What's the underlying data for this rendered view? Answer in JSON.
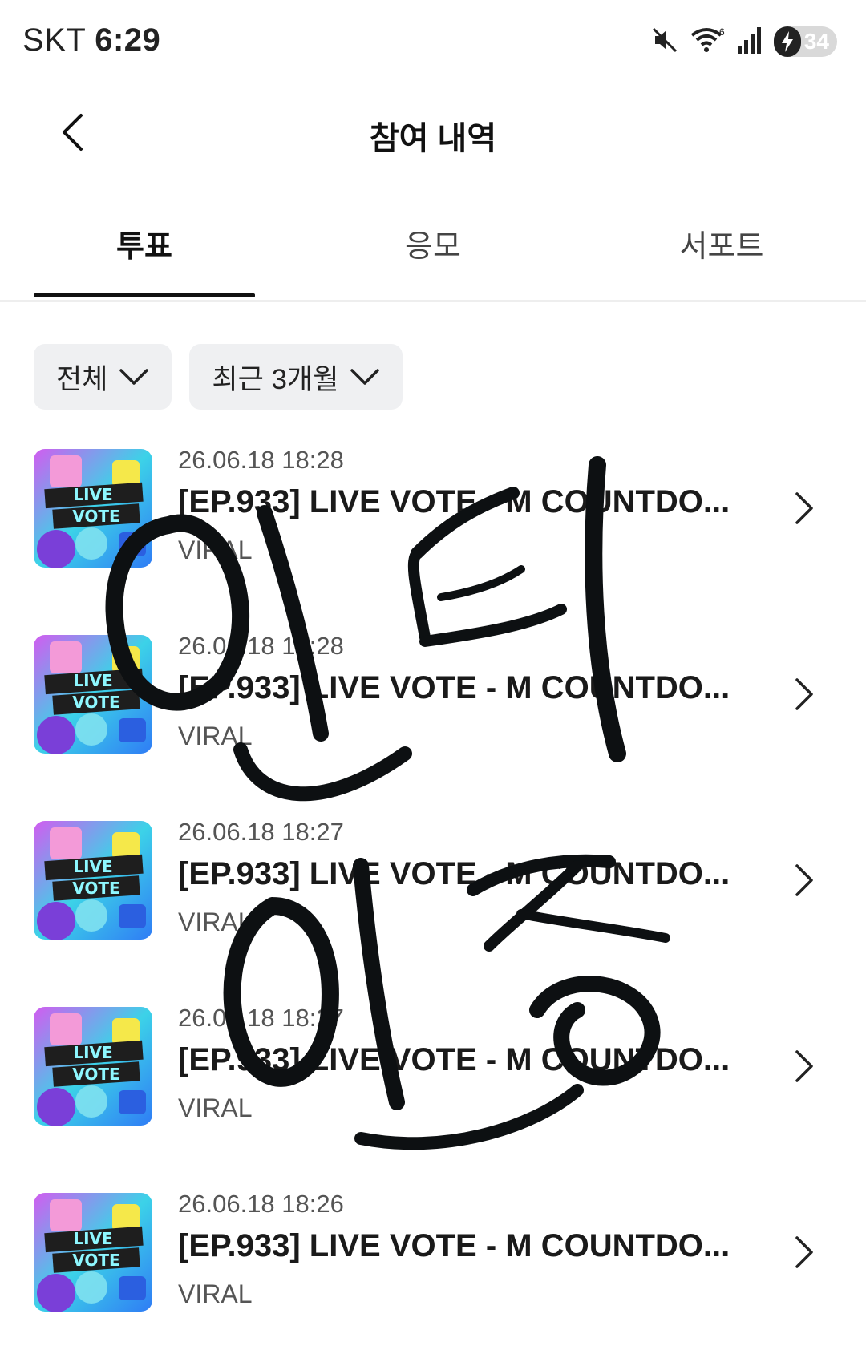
{
  "status_bar": {
    "carrier": "SKT",
    "time": "6:29",
    "battery": "34",
    "icons": [
      "mute-icon",
      "wifi-icon",
      "signal-icon",
      "battery-charging-icon"
    ]
  },
  "header": {
    "title": "참여 내역",
    "back_icon": "chevron-left-icon"
  },
  "tabs": [
    {
      "label": "투표",
      "active": true
    },
    {
      "label": "응모",
      "active": false
    },
    {
      "label": "서포트",
      "active": false
    }
  ],
  "filters": [
    {
      "label": "전체",
      "icon": "chevron-down-icon"
    },
    {
      "label": "최근 3개월",
      "icon": "chevron-down-icon"
    }
  ],
  "items": [
    {
      "date": "26.06.18 18:28",
      "title": "[EP.933] LIVE VOTE - M COUNTDO...",
      "subtitle": "VIRAL",
      "thumbnail_text": [
        "LIVE",
        "VOTE"
      ]
    },
    {
      "date": "26.06.18 18:28",
      "title": "[EP.933] LIVE VOTE - M COUNTDO...",
      "subtitle": "VIRAL",
      "thumbnail_text": [
        "LIVE",
        "VOTE"
      ]
    },
    {
      "date": "26.06.18 18:27",
      "title": "[EP.933] LIVE VOTE - M COUNTDO...",
      "subtitle": "VIRAL",
      "thumbnail_text": [
        "LIVE",
        "VOTE"
      ]
    },
    {
      "date": "26.06.18 18:27",
      "title": "[EP.933] LIVE VOTE - M COUNTDO...",
      "subtitle": "VIRAL",
      "thumbnail_text": [
        "LIVE",
        "VOTE"
      ]
    },
    {
      "date": "26.06.18 18:26",
      "title": "[EP.933] LIVE VOTE - M COUNTDO...",
      "subtitle": "VIRAL",
      "thumbnail_text": [
        "LIVE",
        "VOTE"
      ]
    }
  ],
  "colors": {
    "tab_indicator": "#111111",
    "filter_bg": "#eff0f2",
    "overlay_ink": "#0d1012"
  },
  "overlay": {
    "description_icon": "handwritten-signature",
    "text": "인터 인증"
  }
}
